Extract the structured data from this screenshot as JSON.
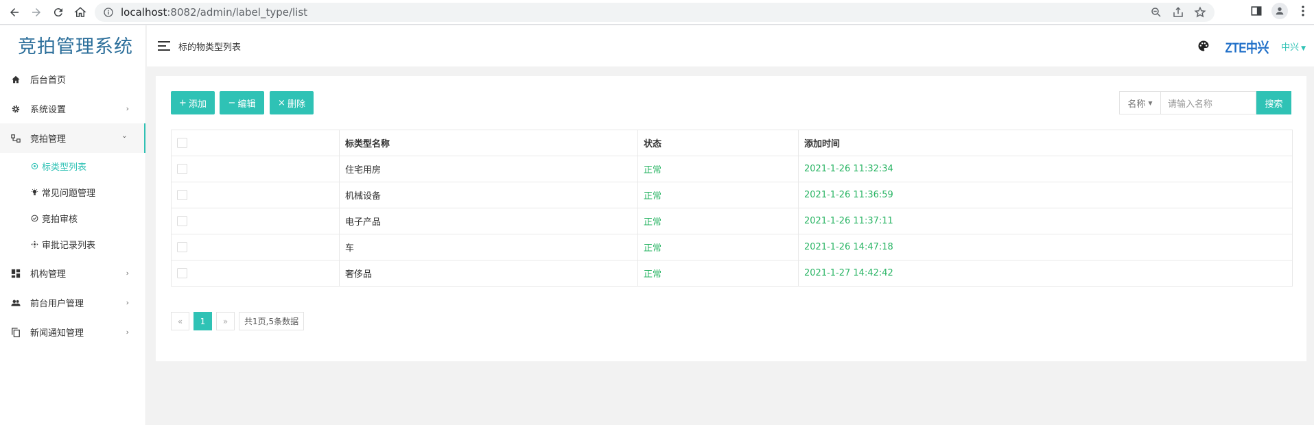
{
  "browser": {
    "url_host": "localhost",
    "url_rest": ":8082/admin/label_type/list"
  },
  "sidebar": {
    "logo": "竞拍管理系统",
    "items": [
      {
        "label": "后台首页",
        "icon": "home-icon"
      },
      {
        "label": "系统设置",
        "icon": "gear-icon",
        "arrow": "›"
      },
      {
        "label": "竞拍管理",
        "icon": "sitemap-icon",
        "arrow": "⌄"
      },
      {
        "label": "机构管理",
        "icon": "dashboard-icon",
        "arrow": "›"
      },
      {
        "label": "前台用户管理",
        "icon": "users-icon",
        "arrow": "›"
      },
      {
        "label": "新闻通知管理",
        "icon": "copy-icon",
        "arrow": "›"
      }
    ],
    "sub_items": [
      {
        "label": "标类型列表",
        "icon": "circle-dot-icon",
        "active": true
      },
      {
        "label": "常见问题管理",
        "icon": "bulb-icon"
      },
      {
        "label": "竞拍审核",
        "icon": "check-circle-icon"
      },
      {
        "label": "审批记录列表",
        "icon": "arrows-icon"
      }
    ]
  },
  "header": {
    "page_title": "标的物类型列表",
    "brand_logo": "ZTE中兴",
    "company": "中兴"
  },
  "toolbar": {
    "add": "添加",
    "edit": "编辑",
    "delete": "删除",
    "search_field": "名称",
    "search_placeholder": "请输入名称",
    "search_button": "搜索"
  },
  "table": {
    "columns": [
      "标类型名称",
      "状态",
      "添加时间"
    ],
    "rows": [
      {
        "name": "住宅用房",
        "status": "正常",
        "time": "2021-1-26 11:32:34"
      },
      {
        "name": "机械设备",
        "status": "正常",
        "time": "2021-1-26 11:36:59"
      },
      {
        "name": "电子产品",
        "status": "正常",
        "time": "2021-1-26 11:37:11"
      },
      {
        "name": "车",
        "status": "正常",
        "time": "2021-1-26 14:47:18"
      },
      {
        "name": "奢侈品",
        "status": "正常",
        "time": "2021-1-27 14:42:42"
      }
    ]
  },
  "pagination": {
    "prev": "«",
    "current": "1",
    "next": "»",
    "info": "共1页,5条数据"
  },
  "colors": {
    "accent": "#2fc2b5",
    "status_green": "#28b463",
    "logo_blue": "#2b6e9a"
  }
}
